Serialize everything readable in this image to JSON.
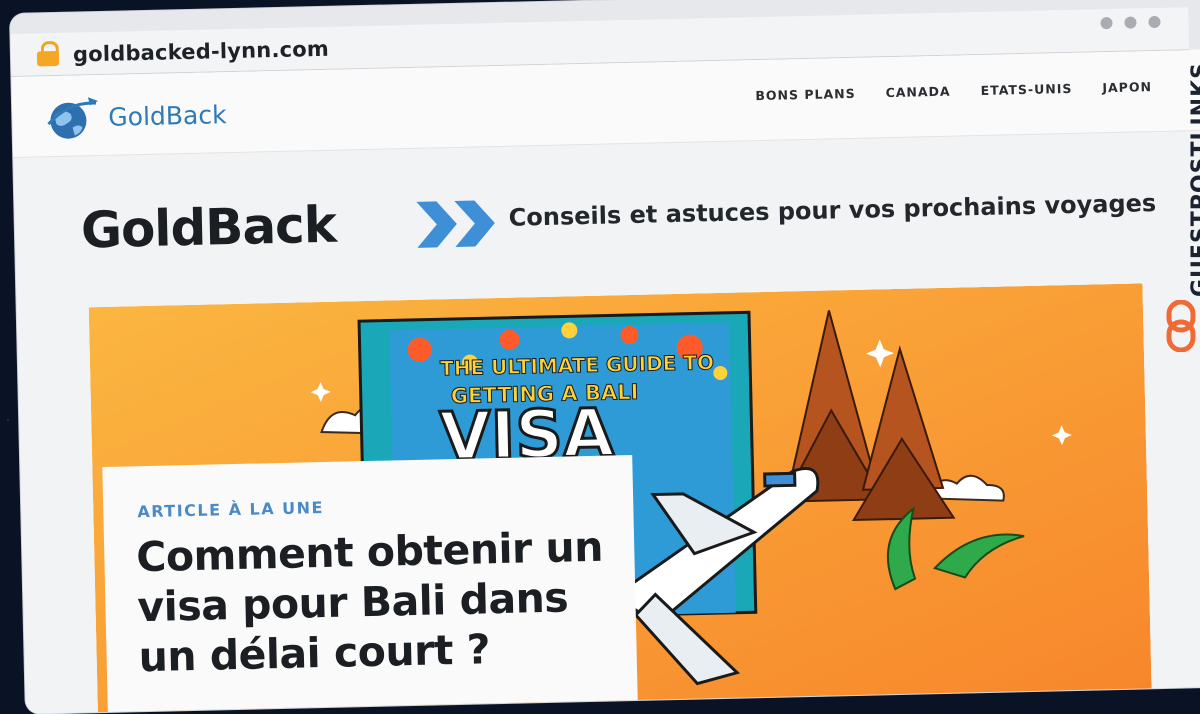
{
  "browser": {
    "url": "goldbacked-lynn.com"
  },
  "nav": {
    "logo_text": "GoldBack",
    "items": [
      {
        "label": "BONS PLANS"
      },
      {
        "label": "CANADA"
      },
      {
        "label": "ETATS-UNIS"
      },
      {
        "label": "JAPON"
      }
    ]
  },
  "hero": {
    "site_title": "GoldBack",
    "tagline": "Conseils et astuces pour vos prochains voyages"
  },
  "banner": {
    "line1": "THE ULTIMATE GUIDE TO",
    "line2": "GETTING A BALI",
    "line3": "VISA"
  },
  "featured": {
    "kicker": "ARTICLE À LA UNE",
    "title": "Comment obtenir un visa pour Bali dans un délai court ?"
  },
  "watermark": {
    "text": "GUESTPOSTLINKS"
  },
  "colors": {
    "accent_blue": "#4a8ac5",
    "banner_orange": "#f7a12b",
    "logo_blue": "#2e79b8",
    "watermark_orange": "#f06a35"
  }
}
